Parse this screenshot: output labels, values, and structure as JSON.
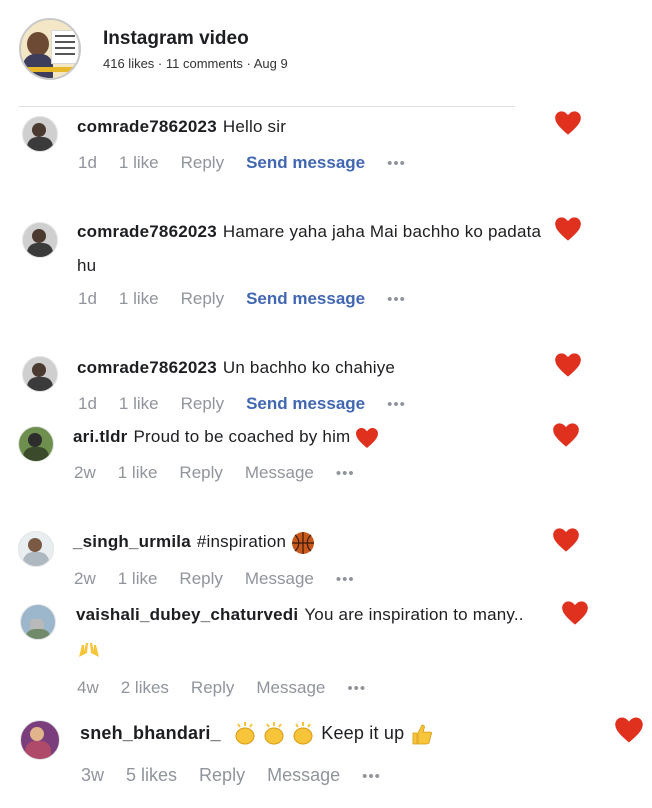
{
  "post": {
    "title": "Instagram video",
    "meta": "416 likes · 11 comments · Aug 9"
  },
  "colors": {
    "heart": "#e0311f",
    "link": "#4267b2",
    "muted": "#90949c"
  },
  "comments": [
    {
      "user": "comrade7862023",
      "text": "Hello sir",
      "time": "1d",
      "likes": "1 like",
      "reply": "Reply",
      "action": "Send message",
      "more": "•••"
    },
    {
      "user": "comrade7862023",
      "text": "Hamare yaha jaha Mai bachho ko padata hu",
      "time": "1d",
      "likes": "1 like",
      "reply": "Reply",
      "action": "Send message",
      "more": "•••"
    },
    {
      "user": "comrade7862023",
      "text": "Un bachho ko chahiye",
      "time": "1d",
      "likes": "1 like",
      "reply": "Reply",
      "action": "Send message",
      "more": "•••"
    },
    {
      "user": "ari.tldr",
      "text": "Proud to be coached by him",
      "time": "2w",
      "likes": "1 like",
      "reply": "Reply",
      "action": "Message",
      "more": "•••"
    },
    {
      "user": "_singh_urmila",
      "text": "#inspiration",
      "time": "2w",
      "likes": "1 like",
      "reply": "Reply",
      "action": "Message",
      "more": "•••"
    },
    {
      "user": "vaishali_dubey_chaturvedi",
      "text": "You are inspiration to many..",
      "time": "4w",
      "likes": "2 likes",
      "reply": "Reply",
      "action": "Message",
      "more": "•••"
    },
    {
      "user": "sneh_bhandari_",
      "text": "Keep it up",
      "time": "3w",
      "likes": "5 likes",
      "reply": "Reply",
      "action": "Message",
      "more": "•••"
    }
  ]
}
